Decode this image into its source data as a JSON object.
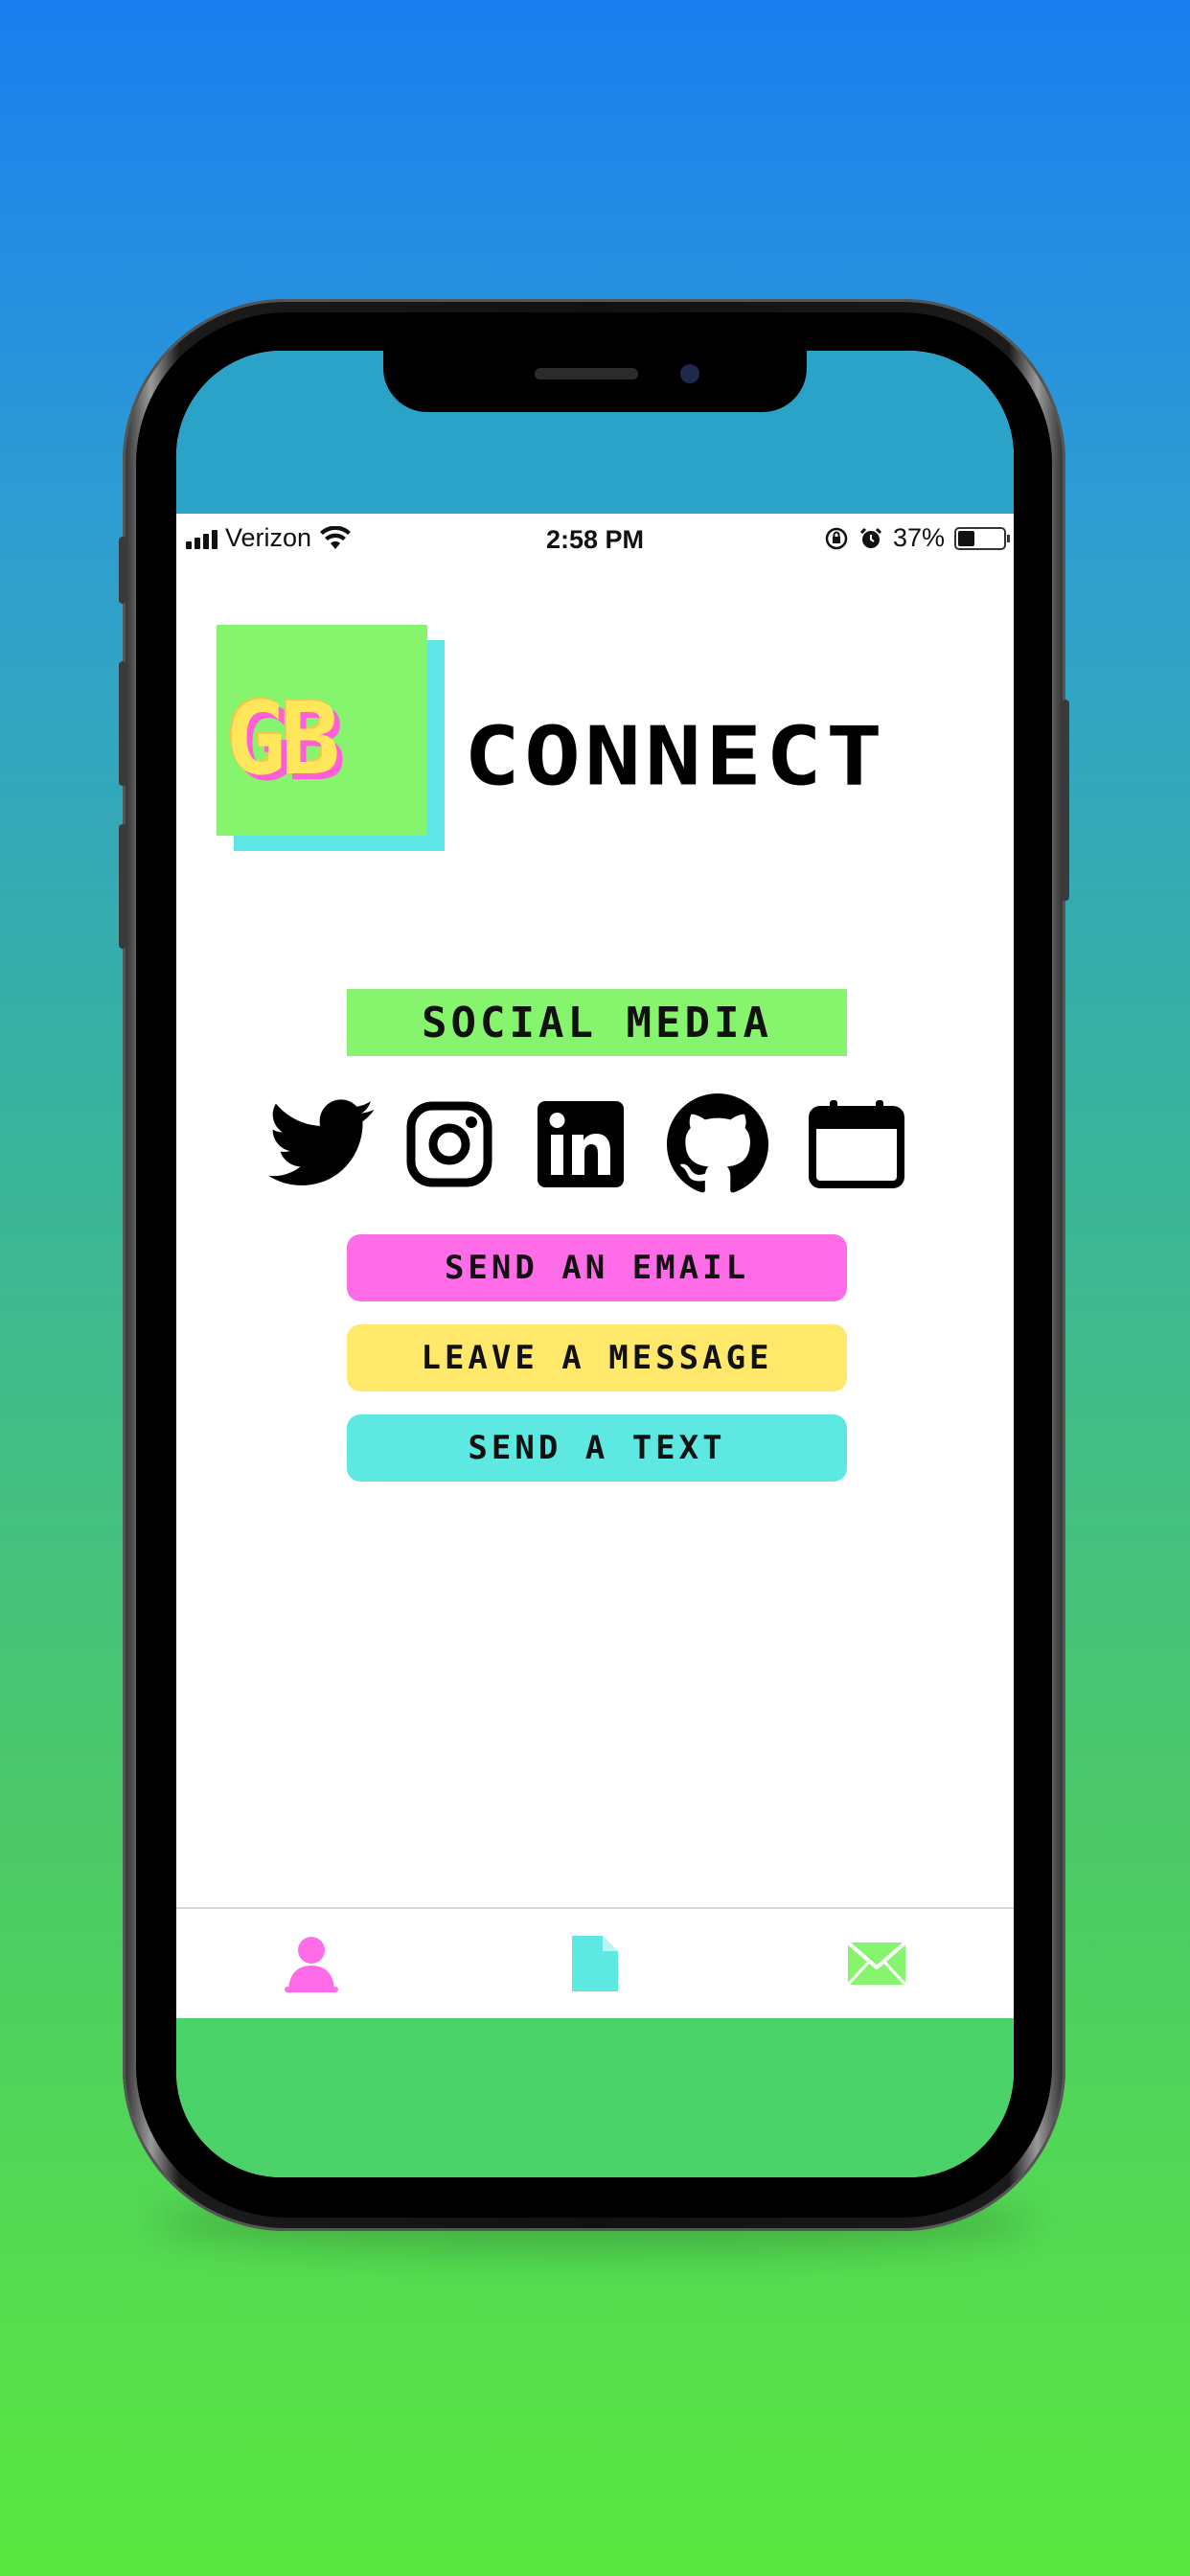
{
  "status_bar": {
    "carrier": "Verizon",
    "time": "2:58 PM",
    "battery_percent_label": "37%",
    "battery_level": 0.37
  },
  "logo": {
    "text": "GB"
  },
  "brand": {
    "title": "CONNECT"
  },
  "section": {
    "label": "SOCIAL MEDIA"
  },
  "social_icons": [
    "twitter-icon",
    "instagram-icon",
    "linkedin-icon",
    "github-icon",
    "calendar-icon"
  ],
  "actions": {
    "email_label": "SEND AN EMAIL",
    "message_label": "LEAVE A MESSAGE",
    "text_label": "SEND A TEXT"
  },
  "tabs": [
    "person-icon",
    "document-icon",
    "mail-icon"
  ],
  "colors": {
    "pink": "#ff6ce8",
    "yellow": "#ffe86a",
    "cyan": "#5de9e2",
    "green": "#86f46c"
  }
}
